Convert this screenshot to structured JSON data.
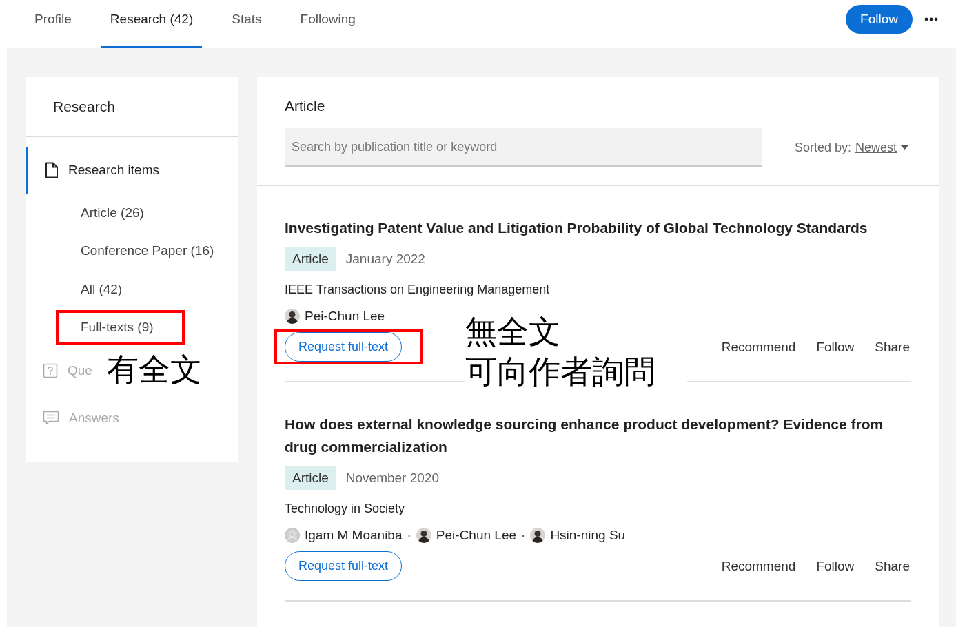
{
  "tabs": [
    {
      "label": "Profile",
      "selected": false
    },
    {
      "label": "Research (42)",
      "selected": true
    },
    {
      "label": "Stats",
      "selected": false
    },
    {
      "label": "Following",
      "selected": false
    }
  ],
  "follow_button": "Follow",
  "sidebar": {
    "title": "Research",
    "section": {
      "label": "Research items",
      "selected": true
    },
    "items": [
      {
        "label": "Article (26)",
        "highlighted": false
      },
      {
        "label": "Conference Paper (16)",
        "highlighted": false
      },
      {
        "label": "All (42)",
        "highlighted": false
      },
      {
        "label": "Full-texts (9)",
        "highlighted": true
      }
    ],
    "other_sections": [
      {
        "label": "Que",
        "kind": "questions",
        "disabled": true
      },
      {
        "label": "Answers",
        "kind": "answers",
        "disabled": true
      }
    ]
  },
  "main": {
    "title": "Article",
    "search": {
      "placeholder": "Search by publication title or keyword"
    },
    "sort_label": "Sorted by:",
    "sort_value": "Newest",
    "articles": [
      {
        "title": "Investigating Patent Value and Litigation Probability of Global Technology Standards",
        "type": "Article",
        "date": "January 2022",
        "journal": "IEEE Transactions on Engineering Management",
        "authors": [
          {
            "name": "Pei-Chun Lee",
            "photo": true
          }
        ],
        "request_button": "Request full-text",
        "request_highlighted": true,
        "actions": [
          "Recommend",
          "Follow",
          "Share"
        ]
      },
      {
        "title": "How does external knowledge sourcing enhance product development? Evidence from drug commercialization",
        "type": "Article",
        "date": "November 2020",
        "journal": "Technology in Society",
        "authors": [
          {
            "name": "Igam M Moaniba",
            "photo": false
          },
          {
            "separator": "·",
            "name": "Pei-Chun Lee",
            "photo": true
          },
          {
            "separator": "·",
            "name": "Hsin-ning Su",
            "photo": true
          }
        ],
        "request_button": "Request full-text",
        "request_highlighted": false,
        "actions": [
          "Recommend",
          "Follow",
          "Share"
        ]
      }
    ]
  },
  "annotations": [
    {
      "lines": [
        "有全文"
      ]
    },
    {
      "lines": [
        "無全文",
        "可向作者詢問"
      ]
    }
  ]
}
